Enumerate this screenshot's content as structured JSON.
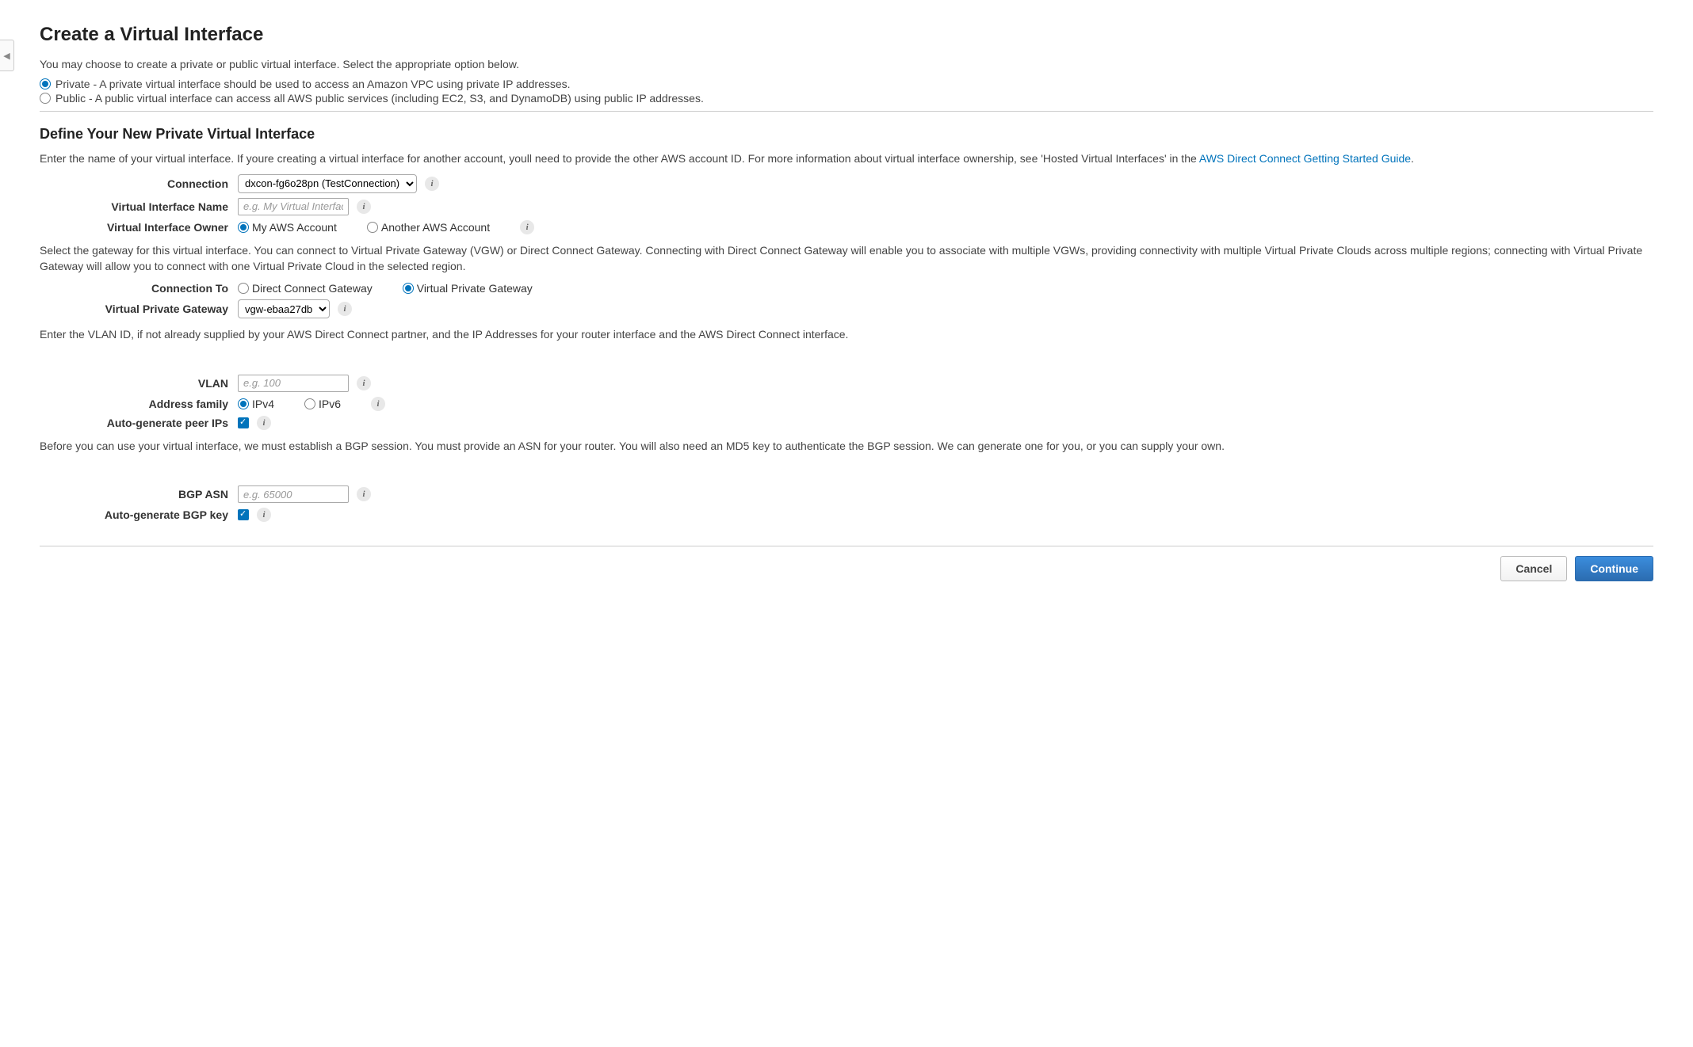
{
  "header": {
    "title": "Create a Virtual Interface",
    "intro": "You may choose to create a private or public virtual interface. Select the appropriate option below.",
    "option_private": "Private - A private virtual interface should be used to access an Amazon VPC using private IP addresses.",
    "option_public": "Public - A public virtual interface can access all AWS public services (including EC2, S3, and DynamoDB) using public IP addresses."
  },
  "section_define": {
    "heading": "Define Your New Private Virtual Interface",
    "text_prefix": "Enter the name of your virtual interface. If youre creating a virtual interface for another account, youll need to provide the other AWS account ID. For more information about virtual interface ownership, see 'Hosted Virtual Interfaces' in the ",
    "link_text": "AWS Direct Connect Getting Started Guide",
    "text_suffix": "."
  },
  "fields": {
    "connection_label": "Connection",
    "connection_value": "dxcon-fg6o28pn (TestConnection)",
    "vif_name_label": "Virtual Interface Name",
    "vif_name_placeholder": "e.g. My Virtual Interface",
    "vif_owner_label": "Virtual Interface Owner",
    "owner_my": "My AWS Account",
    "owner_other": "Another AWS Account",
    "gateway_text": "Select the gateway for this virtual interface. You can connect to Virtual Private Gateway (VGW) or Direct Connect Gateway. Connecting with Direct Connect Gateway will enable you to associate with multiple VGWs, providing connectivity with multiple Virtual Private Clouds across multiple regions; connecting with Virtual Private Gateway will allow you to connect with one Virtual Private Cloud in the selected region.",
    "connection_to_label": "Connection To",
    "conn_to_dcg": "Direct Connect Gateway",
    "conn_to_vpg": "Virtual Private Gateway",
    "vpg_label": "Virtual Private Gateway",
    "vpg_value": "vgw-ebaa27db",
    "vlan_text": "Enter the VLAN ID, if not already supplied by your AWS Direct Connect partner, and the IP Addresses for your router interface and the AWS Direct Connect interface.",
    "vlan_label": "VLAN",
    "vlan_placeholder": "e.g. 100",
    "addr_family_label": "Address family",
    "addr_ipv4": "IPv4",
    "addr_ipv6": "IPv6",
    "auto_peer_label": "Auto-generate peer IPs",
    "bgp_text": "Before you can use your virtual interface, we must establish a BGP session. You must provide an ASN for your router. You will also need an MD5 key to authenticate the BGP session. We can generate one for you, or you can supply your own.",
    "bgp_asn_label": "BGP ASN",
    "bgp_asn_placeholder": "e.g. 65000",
    "auto_bgp_key_label": "Auto-generate BGP key"
  },
  "footer": {
    "cancel": "Cancel",
    "continue": "Continue"
  }
}
